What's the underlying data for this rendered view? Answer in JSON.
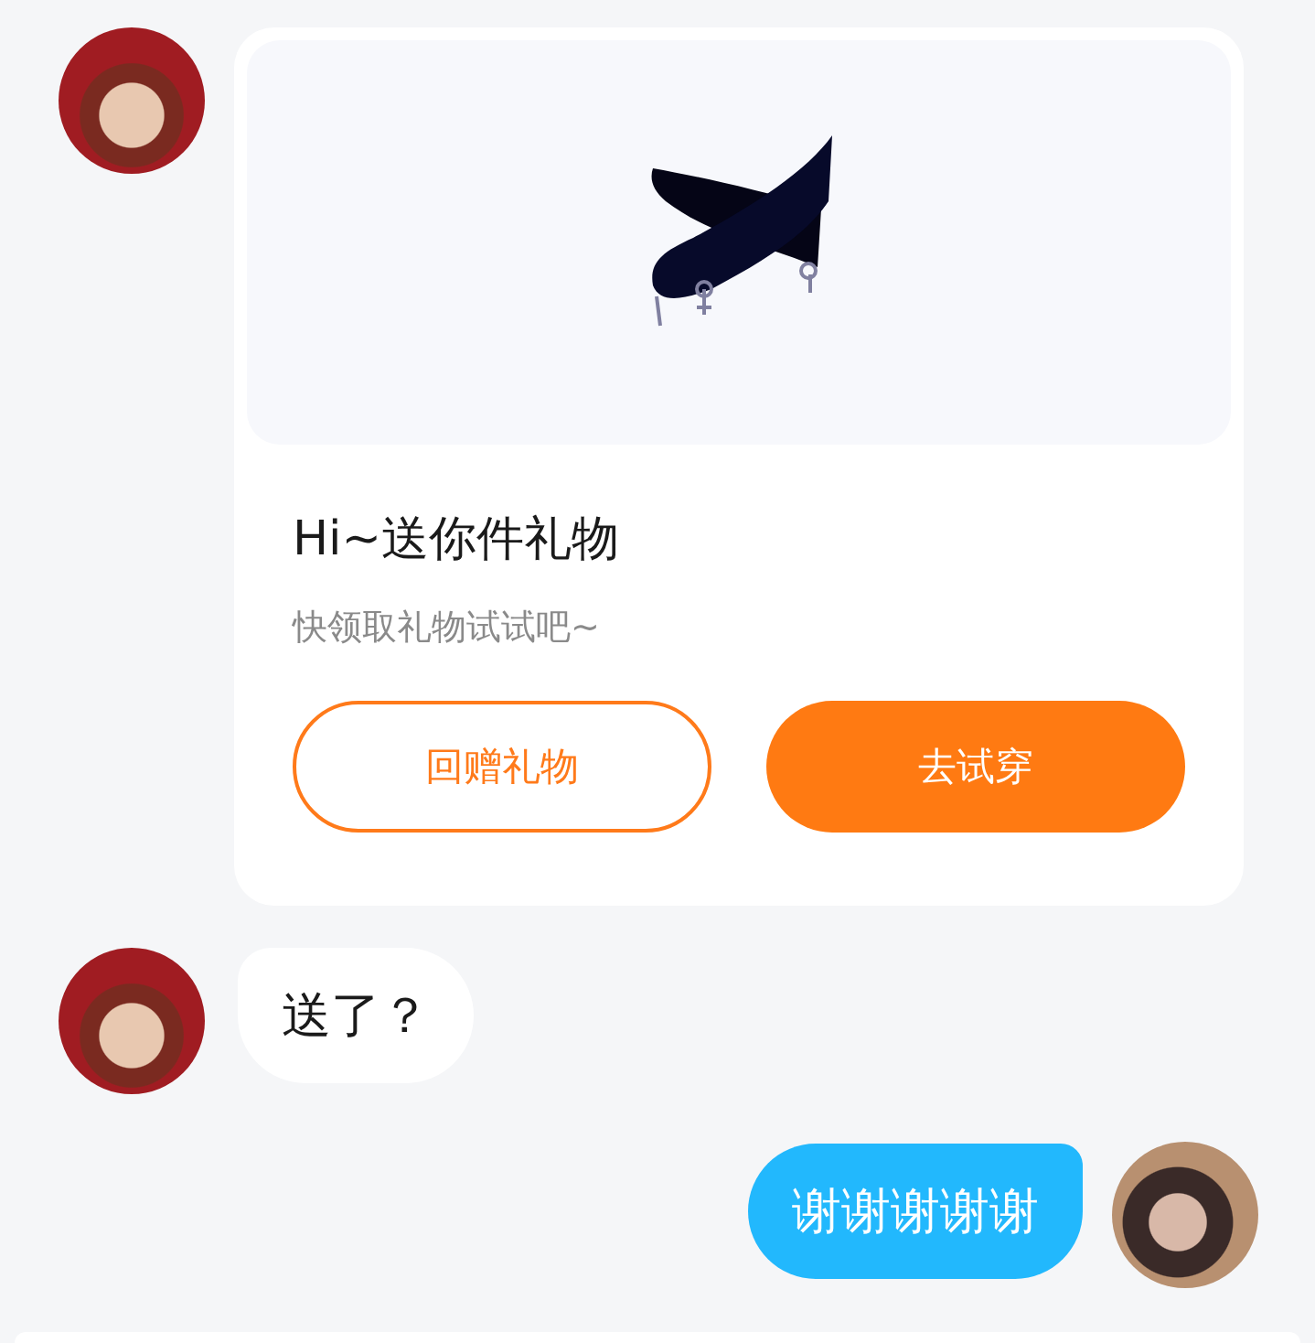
{
  "messages": [
    {
      "kind": "gift_card",
      "outgoing": false,
      "title": "Hi~送你件礼物",
      "subtitle": "快领取礼物试试吧~",
      "buttons": [
        {
          "label": "回赠礼物",
          "kind": "outline"
        },
        {
          "label": "去试穿",
          "kind": "filled"
        }
      ]
    },
    {
      "kind": "text",
      "outgoing": false,
      "text": "送了？"
    },
    {
      "kind": "text",
      "outgoing": true,
      "text": "谢谢谢谢谢"
    }
  ]
}
